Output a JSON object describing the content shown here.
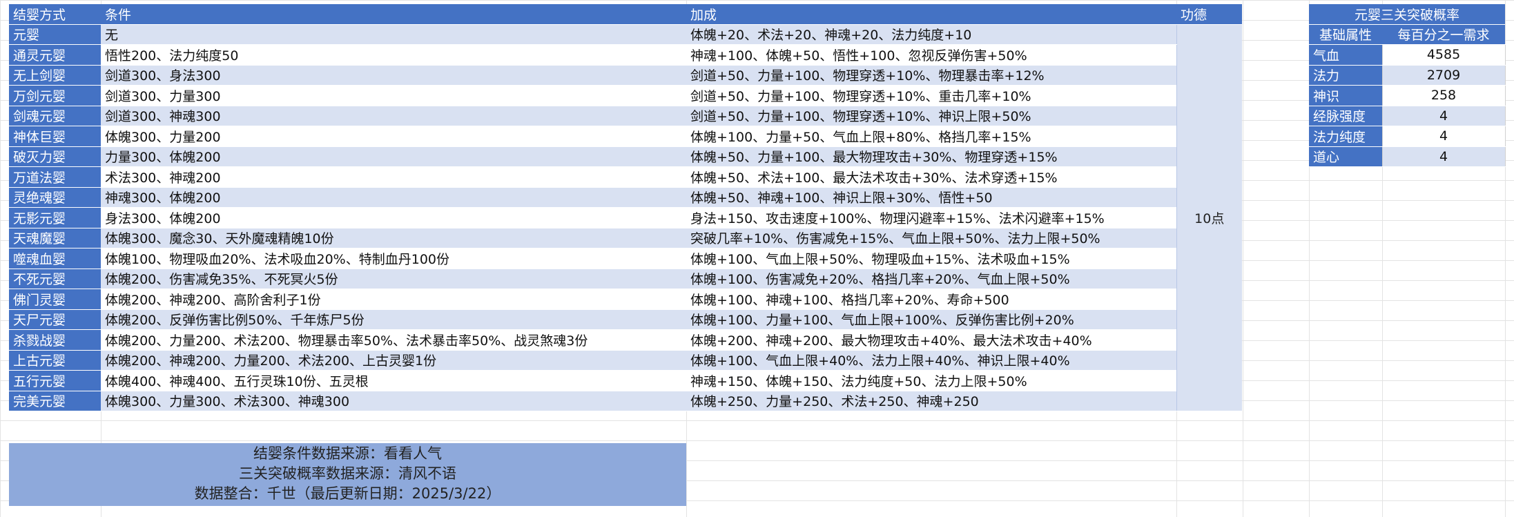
{
  "main_table": {
    "headers": {
      "method": "结婴方式",
      "condition": "条件",
      "bonus": "加成",
      "merit": "功德"
    },
    "merit_value": "10点",
    "rows": [
      {
        "name": "元婴",
        "condition": "无",
        "bonus": "体魄+20、术法+20、神魂+20、法力纯度+10"
      },
      {
        "name": "通灵元婴",
        "condition": "悟性200、法力纯度50",
        "bonus": "神魂+100、体魄+50、悟性+100、忽视反弹伤害+50%"
      },
      {
        "name": "无上剑婴",
        "condition": "剑道300、身法300",
        "bonus": "剑道+50、力量+100、物理穿透+10%、物理暴击率+12%"
      },
      {
        "name": "万剑元婴",
        "condition": "剑道300、力量300",
        "bonus": "剑道+50、力量+100、物理穿透+10%、重击几率+10%"
      },
      {
        "name": "剑魂元婴",
        "condition": "剑道300、神魂300",
        "bonus": "剑道+50、力量+100、物理穿透+10%、神识上限+50%"
      },
      {
        "name": "神体巨婴",
        "condition": "体魄300、力量200",
        "bonus": "体魄+100、力量+50、气血上限+80%、格挡几率+15%"
      },
      {
        "name": "破灭力婴",
        "condition": "力量300、体魄200",
        "bonus": "体魄+50、力量+100、最大物理攻击+30%、物理穿透+15%"
      },
      {
        "name": "万道法婴",
        "condition": "术法300、神魂200",
        "bonus": "体魄+50、术法+100、最大法术攻击+30%、法术穿透+15%"
      },
      {
        "name": "灵绝魂婴",
        "condition": "神魂300、体魄200",
        "bonus": "体魄+50、神魂+100、神识上限+30%、悟性+50"
      },
      {
        "name": "无影元婴",
        "condition": "身法300、体魄200",
        "bonus": "身法+150、攻击速度+100%、物理闪避率+15%、法术闪避率+15%"
      },
      {
        "name": "天魂魔婴",
        "condition": "体魄300、魔念30、天外魔魂精魄10份",
        "bonus": "突破几率+10%、伤害减免+15%、气血上限+50%、法力上限+50%"
      },
      {
        "name": "噬魂血婴",
        "condition": "体魄100、物理吸血20%、法术吸血20%、特制血丹100份",
        "bonus": "体魄+100、气血上限+50%、物理吸血+15%、法术吸血+15%"
      },
      {
        "name": "不死元婴",
        "condition": "体魄200、伤害减免35%、不死冥火5份",
        "bonus": "体魄+100、伤害减免+20%、格挡几率+20%、气血上限+50%"
      },
      {
        "name": "佛门灵婴",
        "condition": "体魄200、神魂200、高阶舍利子1份",
        "bonus": "体魄+100、神魂+100、格挡几率+20%、寿命+500"
      },
      {
        "name": "天尸元婴",
        "condition": "体魄200、反弹伤害比例50%、千年炼尸5份",
        "bonus": "体魄+100、力量+100、气血上限+100%、反弹伤害比例+20%"
      },
      {
        "name": "杀戮战婴",
        "condition": "体魄200、力量200、术法200、物理暴击率50%、法术暴击率50%、战灵煞魂3份",
        "bonus": "体魄+200、神魂+200、最大物理攻击+40%、最大法术攻击+40%"
      },
      {
        "name": "上古元婴",
        "condition": "体魄200、神魂200、力量200、术法200、上古灵婴1份",
        "bonus": "体魄+100、气血上限+40%、法力上限+40%、神识上限+40%"
      },
      {
        "name": "五行元婴",
        "condition": "体魄400、神魂400、五行灵珠10份、五灵根",
        "bonus": "神魂+150、体魄+150、法力纯度+50、法力上限+50%"
      },
      {
        "name": "完美元婴",
        "condition": "体魄300、力量300、术法300、神魂300",
        "bonus": "体魄+250、力量+250、术法+250、神魂+250"
      }
    ]
  },
  "side_table": {
    "title": "元婴三关突破概率",
    "col1": "基础属性",
    "col2": "每百分之一需求",
    "rows": [
      {
        "attr": "气血",
        "value": "4585"
      },
      {
        "attr": "法力",
        "value": "2709"
      },
      {
        "attr": "神识",
        "value": "258"
      },
      {
        "attr": "经脉强度",
        "value": "4"
      },
      {
        "attr": "法力纯度",
        "value": "4"
      },
      {
        "attr": "道心",
        "value": "4"
      }
    ]
  },
  "footer": {
    "line1": "结婴条件数据来源：看看人气",
    "line2": "三关突破概率数据来源：清风不语",
    "line3": "数据整合：千世（最后更新日期：2025/3/22）"
  },
  "colors": {
    "header_blue": "#4472c4",
    "band_light": "#d9e1f2",
    "footer_blue": "#8ea9db"
  }
}
